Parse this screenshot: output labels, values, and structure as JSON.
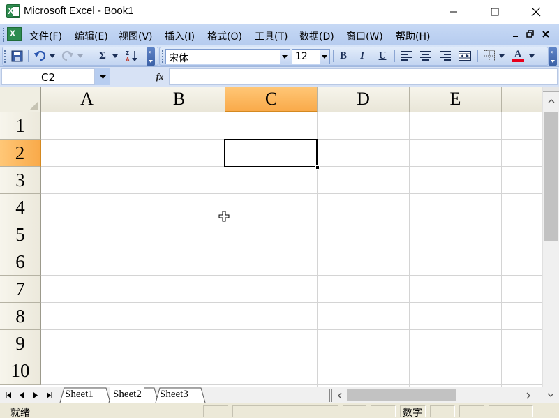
{
  "window": {
    "title": "Microsoft Excel - Book1"
  },
  "menu": {
    "items": [
      "文件(F)",
      "编辑(E)",
      "视图(V)",
      "插入(I)",
      "格式(O)",
      "工具(T)",
      "数据(D)",
      "窗口(W)",
      "帮助(H)"
    ]
  },
  "toolbar": {
    "font_name": "宋体",
    "font_size": "12",
    "bold_label": "B",
    "italic_label": "I",
    "underline_label": "U",
    "sum_label": "Σ",
    "font_color_label": "A",
    "font_color": "#e8001c"
  },
  "formula_bar": {
    "name_box": "C2",
    "fx_label": "fx",
    "formula": ""
  },
  "grid": {
    "columns": [
      "A",
      "B",
      "C",
      "D",
      "E"
    ],
    "rows": [
      "1",
      "2",
      "3",
      "4",
      "5",
      "6",
      "7",
      "8",
      "9",
      "10"
    ],
    "selected_column": "C",
    "selected_row": "2"
  },
  "sheets": {
    "tabs": [
      "Sheet1",
      "Sheet2",
      "Sheet3"
    ],
    "active": "Sheet2"
  },
  "status": {
    "ready": "就绪",
    "num_lock": "数字"
  },
  "colors": {
    "selection_header": "#f9aa4a",
    "toolbar_blue": "#c3d5f1",
    "excel_green": "#2e8b4f"
  }
}
